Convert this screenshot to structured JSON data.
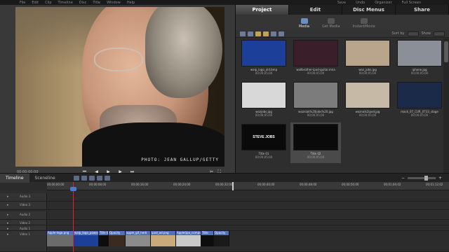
{
  "app": {
    "menu": [
      "File",
      "Edit",
      "Clip",
      "Timeline",
      "Disc",
      "Title",
      "Window",
      "Help"
    ],
    "right": [
      "Save",
      "Undo",
      "Organizer",
      "Full Screen"
    ]
  },
  "monitor": {
    "caption": "PHOTO: JEAN GALLUP/GETTY",
    "timecode": "00;00;00;00"
  },
  "panel": {
    "tabs": [
      "Project",
      "Edit",
      "Disc Menus",
      "Share"
    ],
    "subtabs": [
      "Media",
      "Get Media",
      "InstantMovie"
    ],
    "sort_label": "Sort by",
    "show_label": "Show"
  },
  "clips": [
    {
      "name": "walp_logo_old.bmp",
      "dur": "00;00;05;00",
      "color": "#1c3f9a"
    },
    {
      "name": "wallbrother-ipod-guitar.mna",
      "dur": "00;00;05;00",
      "color": "#3a1e2a"
    },
    {
      "name": "woz_jobs.jpg",
      "dur": "00;00;05;00",
      "color": "#b9a48c"
    },
    {
      "name": "iphone.jpg",
      "dur": "00;00;05;00",
      "color": "#8b8f97"
    },
    {
      "name": "wozjobs.jpg",
      "dur": "00;00;05;00",
      "color": "#d8d8d8"
    },
    {
      "name": "wozniak%20jobs%20.jpg",
      "dur": "00;00;05;00",
      "color": "#7c7c7c"
    },
    {
      "name": "woznaik2ipod.jpg",
      "dur": "00;00;05;00",
      "color": "#c6b9a6"
    },
    {
      "name": "mack_07_CUR_0733_stage",
      "dur": "00;00;05;00",
      "color": "#1a2a48"
    },
    {
      "name": "Title 01",
      "dur": "00;00;05;00",
      "color": "#0a0a0a",
      "text": "STEVE JOBS"
    },
    {
      "name": "Title 02",
      "dur": "00;00;05;00",
      "color": "#0a0a0a"
    }
  ],
  "timeline": {
    "tabs": [
      "Timeline",
      "Sceneline"
    ],
    "ticks": [
      "00;00;00;00",
      "00;00;08;00",
      "00;00;16;00",
      "00;00;24;00",
      "00;00;32;00",
      "00;00;40;00",
      "00;00;48;00",
      "00;00;56;00",
      "00;01;04;02",
      "00;01;12;02"
    ],
    "tracks": [
      "Audio 3",
      "Video 3",
      "Audio 2",
      "Video 2",
      "Audio 1",
      "Video 1"
    ],
    "strip": [
      {
        "label": "Apple-logo.png",
        "w": 38,
        "color": "#6b6b6b"
      },
      {
        "label": "walp_logo_power",
        "w": 36,
        "color": "#1c3f9a"
      },
      {
        "label": "Title 01",
        "w": 14,
        "color": "#0d0d0d"
      },
      {
        "label": "Opacity",
        "w": 24,
        "color": "#3a2a20"
      },
      {
        "label": "apple_gif_herb",
        "w": 36,
        "color": "#8c8c8c"
      },
      {
        "label": "ipod_ad.png",
        "w": 36,
        "color": "#caa97b"
      },
      {
        "label": "Apple(ipo_comps",
        "w": 36,
        "color": "#c9c9c9"
      },
      {
        "label": "Title",
        "w": 18,
        "color": "#0d0d0d"
      },
      {
        "label": "Opacity",
        "w": 22,
        "color": "#1a1a1a"
      }
    ]
  }
}
